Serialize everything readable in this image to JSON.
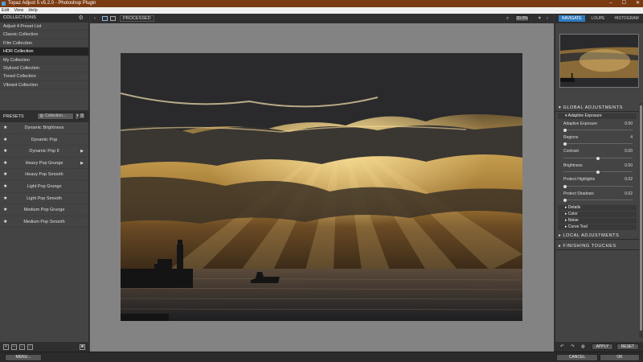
{
  "window": {
    "title": "Topaz Adjust 5 v5.2.0 - Photoshop Plugin",
    "controls": [
      "–",
      "☐",
      "✕"
    ]
  },
  "menu": [
    "Edit",
    "View",
    "Help"
  ],
  "collections": {
    "header": "COLLECTIONS",
    "items": [
      "Adjust 4 Preset List",
      "Classic Collection",
      "Film Collection",
      "HDR Collection",
      "My Collection",
      "Stylized Collection",
      "Toned Collection",
      "Vibrant Collection"
    ],
    "selected_index": 3
  },
  "presets": {
    "header": "PRESETS",
    "filter_placeholder": "Collection...",
    "items": [
      "Dynamic Brightness",
      "Dynamic Pop",
      "Dynamic Pop II",
      "Heavy Pop Grunge",
      "Heavy Pop Smooth",
      "Light Pop Grunge",
      "Light Pop Smooth",
      "Medium Pop Grunge",
      "Medium Pop Smooth"
    ]
  },
  "toolbar": {
    "view_mode": "PROCESSED",
    "zoom": "20.0%"
  },
  "right_tabs": [
    "NAVIGATE",
    "LOUPE",
    "HISTOGRAM"
  ],
  "active_tab": "NAVIGATE",
  "global": {
    "header": "GLOBAL ADJUSTMENTS",
    "adaptive_title": "Adaptive Exposure",
    "params": [
      {
        "label": "Adaptive Exposure",
        "value": "0.00",
        "level": 0.0
      },
      {
        "label": "Regions",
        "value": "4",
        "level": 0.0
      },
      {
        "label": "Contrast",
        "value": "0.00",
        "level": 0.5
      },
      {
        "label": "Brightness",
        "value": "0.00",
        "level": 0.5
      },
      {
        "label": "Protect Highlights",
        "value": "0.02",
        "level": 0.0
      },
      {
        "label": "Protect Shadows",
        "value": "0.02",
        "level": 0.0
      }
    ],
    "subsections": [
      "Details",
      "Color",
      "Noise",
      "Curve Tool"
    ]
  },
  "local": {
    "header": "LOCAL ADJUSTMENTS"
  },
  "finishing": {
    "header": "FINISHING TOUCHES"
  },
  "actions": {
    "apply": "APPLY",
    "reset": "RESET",
    "menu": "MENU...",
    "cancel": "CANCEL",
    "ok": "OK"
  }
}
